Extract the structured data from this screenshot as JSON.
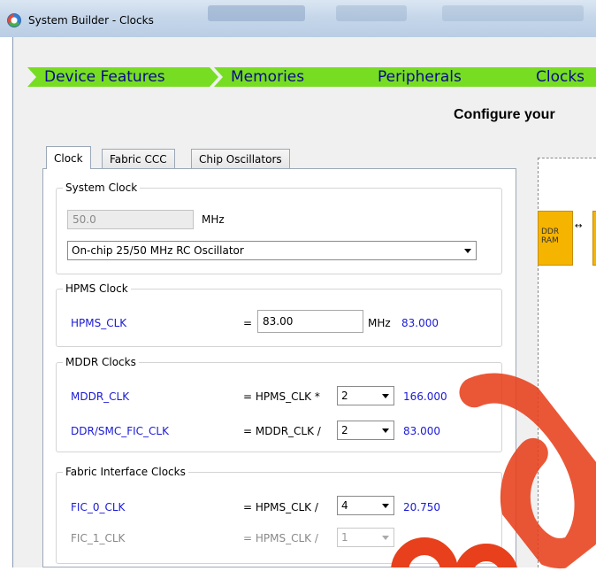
{
  "window": {
    "title": "System Builder - Clocks"
  },
  "breadcrumb": [
    {
      "label": "Device Features"
    },
    {
      "label": "Memories"
    },
    {
      "label": "Peripherals"
    },
    {
      "label": "Clocks"
    }
  ],
  "heading": "Configure your",
  "tabs": [
    {
      "label": "Clock",
      "active": true
    },
    {
      "label": "Fabric CCC",
      "active": false
    },
    {
      "label": "Chip Oscillators",
      "active": false
    }
  ],
  "system_clock": {
    "title": "System Clock",
    "frequency_value": "50.0",
    "unit": "MHz",
    "source_selected": "On-chip 25/50 MHz RC Oscillator"
  },
  "hpms_clock": {
    "title": "HPMS Clock",
    "label": "HPMS_CLK",
    "equals": "=",
    "value": "83.00",
    "unit": "MHz",
    "actual": "83.000"
  },
  "mddr_clocks": {
    "title": "MDDR Clocks",
    "rows": [
      {
        "label": "MDDR_CLK",
        "formula": "= HPMS_CLK *",
        "selected": "2",
        "result": "166.000"
      },
      {
        "label": "DDR/SMC_FIC_CLK",
        "formula": "= MDDR_CLK /",
        "selected": "2",
        "result": "83.000"
      }
    ]
  },
  "fabric_clocks": {
    "title": "Fabric Interface Clocks",
    "rows": [
      {
        "label": "FIC_0_CLK",
        "formula": "= HPMS_CLK /",
        "selected": "4",
        "result": "20.750",
        "enabled": true
      },
      {
        "label": "FIC_1_CLK",
        "formula": "= HPMS_CLK /",
        "selected": "1",
        "result": "",
        "enabled": false
      }
    ]
  },
  "diagram": {
    "ddr_label": "DDR RAM",
    "ddr_line1": "DDR",
    "ddr_line2": "RAM",
    "arrow": "↔"
  },
  "colors": {
    "breadcrumb": "#77dd22",
    "value_blue": "#1a1ad6",
    "ddr_box": "#f5b400"
  },
  "icons": [
    "app-logo-icon",
    "dropdown-arrow-icon",
    "double-arrow-icon"
  ]
}
